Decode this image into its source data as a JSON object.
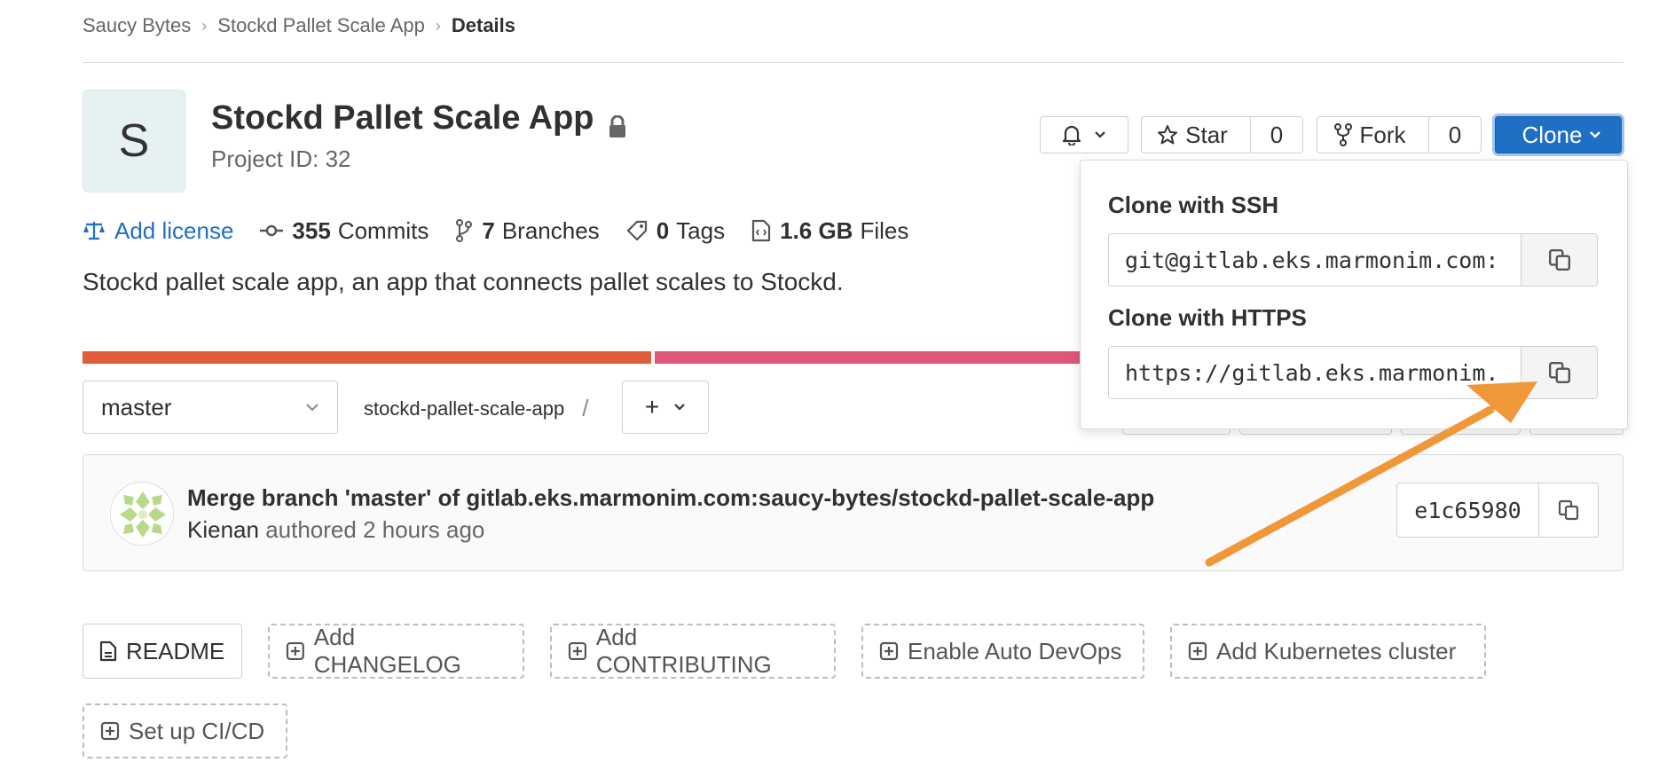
{
  "breadcrumb": [
    "Saucy Bytes",
    "Stockd Pallet Scale App",
    "Details"
  ],
  "project": {
    "avatar_letter": "S",
    "title": "Stockd Pallet Scale App",
    "id_label": "Project ID: 32",
    "description": "Stockd pallet scale app, an app that connects pallet scales to Stockd."
  },
  "actions": {
    "star_label": "Star",
    "star_count": "0",
    "fork_label": "Fork",
    "fork_count": "0",
    "clone_label": "Clone"
  },
  "stats": {
    "license": "Add license",
    "commits_count": "355",
    "commits_label": "Commits",
    "branches_count": "7",
    "branches_label": "Branches",
    "tags_count": "0",
    "tags_label": "Tags",
    "files_size": "1.6 GB",
    "files_label": "Files"
  },
  "languages": [
    {
      "color": "#e05d3a",
      "fraction": 0.37
    },
    {
      "color": "#e0567a",
      "fraction": 0.63
    }
  ],
  "repo": {
    "branch": "master",
    "path": "stockd-pallet-scale-app",
    "slash": "/",
    "add_symbol": "+"
  },
  "commit": {
    "title": "Merge branch 'master' of gitlab.eks.marmonim.com:saucy-bytes/stockd-pallet-scale-app",
    "author": "Kienan",
    "authored_text": "authored 2 hours ago",
    "sha": "e1c65980"
  },
  "quick_actions": [
    "README",
    "Add CHANGELOG",
    "Add CONTRIBUTING",
    "Enable Auto DevOps",
    "Add Kubernetes cluster",
    "Set up CI/CD"
  ],
  "clone_dropdown": {
    "ssh_label": "Clone with SSH",
    "ssh_url": "git@gitlab.eks.marmonim.com:",
    "https_label": "Clone with HTTPS",
    "https_url": "https://gitlab.eks.marmonim."
  },
  "colors": {
    "accent": "#1f6fc5",
    "annotation_arrow": "#f0973a"
  }
}
